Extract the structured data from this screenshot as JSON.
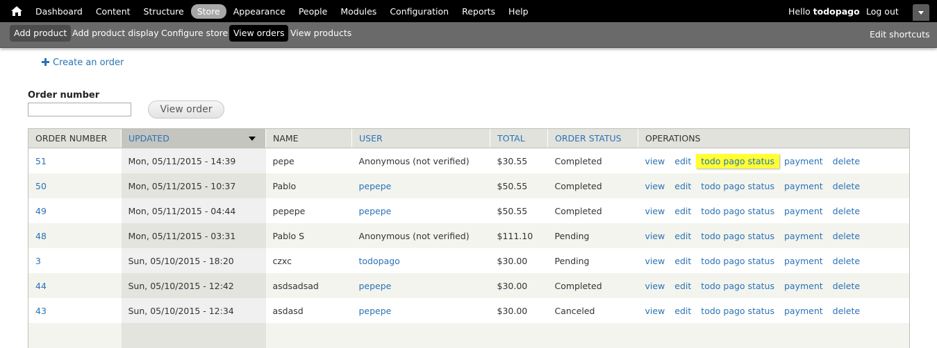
{
  "toolbar": {
    "menu": [
      "Dashboard",
      "Content",
      "Structure",
      "Store",
      "Appearance",
      "People",
      "Modules",
      "Configuration",
      "Reports",
      "Help"
    ],
    "active_item": "Store",
    "hello_prefix": "Hello ",
    "username": "todopago",
    "logout": "Log out"
  },
  "shortcuts": {
    "items": [
      "Add product",
      "Add product display",
      "Configure store",
      "View orders",
      "View products"
    ],
    "edit": "Edit shortcuts"
  },
  "create_order": "Create an order",
  "filter": {
    "label": "Order number",
    "value": "",
    "button": "View order"
  },
  "table": {
    "headers": [
      "ORDER NUMBER",
      "UPDATED",
      "NAME",
      "USER",
      "TOTAL",
      "ORDER STATUS",
      "OPERATIONS"
    ],
    "operations": [
      "view",
      "edit",
      "todo pago status",
      "payment",
      "delete"
    ],
    "rows": [
      {
        "number": "51",
        "updated": "Mon, 05/11/2015 - 14:39",
        "name": "pepe",
        "user": "Anonymous (not verified)",
        "user_link": false,
        "total": "$30.55",
        "status": "Completed"
      },
      {
        "number": "50",
        "updated": "Mon, 05/11/2015 - 10:37",
        "name": "Pablo",
        "user": "pepepe",
        "user_link": true,
        "total": "$50.55",
        "status": "Completed"
      },
      {
        "number": "49",
        "updated": "Mon, 05/11/2015 - 04:44",
        "name": "pepepe",
        "user": "pepepe",
        "user_link": true,
        "total": "$50.55",
        "status": "Completed"
      },
      {
        "number": "48",
        "updated": "Mon, 05/11/2015 - 03:31",
        "name": "Pablo S",
        "user": "Anonymous (not verified)",
        "user_link": false,
        "total": "$111.10",
        "status": "Pending"
      },
      {
        "number": "3",
        "updated": "Sun, 05/10/2015 - 18:20",
        "name": "czxc",
        "user": "todopago",
        "user_link": true,
        "total": "$30.00",
        "status": "Pending"
      },
      {
        "number": "44",
        "updated": "Sun, 05/10/2015 - 12:42",
        "name": "asdsadsad",
        "user": "pepepe",
        "user_link": true,
        "total": "$30.00",
        "status": "Completed"
      },
      {
        "number": "43",
        "updated": "Sun, 05/10/2015 - 12:34",
        "name": "asdasd",
        "user": "pepepe",
        "user_link": true,
        "total": "$30.00",
        "status": "Canceled"
      },
      {
        "number": "",
        "updated": "",
        "name": "",
        "user": "",
        "user_link": false,
        "total": "",
        "status": ""
      }
    ]
  },
  "colors": {
    "toolbar": "#000000",
    "shortcut_bar": "#6a6a6a",
    "link": "#2a72b5",
    "highlight": "#ffff33"
  }
}
